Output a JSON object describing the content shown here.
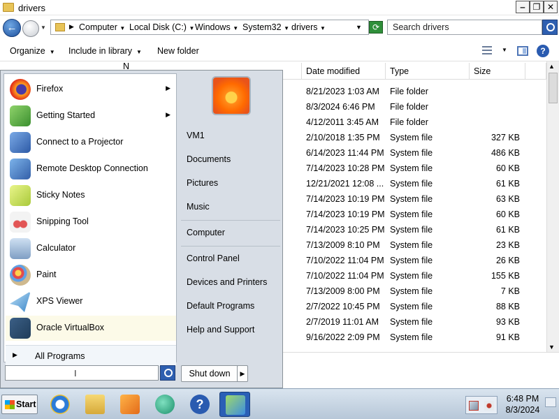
{
  "window": {
    "title": "drivers",
    "minimize_glyph": "‒",
    "maximize_glyph": "❐",
    "close_glyph": "✕"
  },
  "address": {
    "crumbs": [
      "Computer",
      "Local Disk (C:)",
      "Windows",
      "System32",
      "drivers"
    ],
    "search_placeholder": "Search drivers"
  },
  "toolbar": {
    "organize": "Organize",
    "include_in_library": "Include in library",
    "new_folder": "New folder"
  },
  "filelist": {
    "header_name_partial": "N",
    "headers": {
      "date": "Date modified",
      "type": "Type",
      "size": "Size"
    },
    "rows": [
      {
        "date": "8/21/2023 1:03 AM",
        "type": "File folder",
        "size": ""
      },
      {
        "date": "8/3/2024 6:46 PM",
        "type": "File folder",
        "size": ""
      },
      {
        "date": "4/12/2011 3:45 AM",
        "type": "File folder",
        "size": ""
      },
      {
        "date": "2/10/2018 1:35 PM",
        "type": "System file",
        "size": "327 KB"
      },
      {
        "date": "6/14/2023 11:44 PM",
        "type": "System file",
        "size": "486 KB"
      },
      {
        "date": "7/14/2023 10:28 PM",
        "type": "System file",
        "size": "60 KB"
      },
      {
        "date": "12/21/2021 12:08 ...",
        "type": "System file",
        "size": "61 KB"
      },
      {
        "date": "7/14/2023 10:19 PM",
        "type": "System file",
        "size": "63 KB"
      },
      {
        "date": "7/14/2023 10:19 PM",
        "type": "System file",
        "size": "60 KB"
      },
      {
        "date": "7/14/2023 10:25 PM",
        "type": "System file",
        "size": "61 KB"
      },
      {
        "date": "7/13/2009 8:10 PM",
        "type": "System file",
        "size": "23 KB"
      },
      {
        "date": "7/10/2022 11:04 PM",
        "type": "System file",
        "size": "26 KB"
      },
      {
        "date": "7/10/2022 11:04 PM",
        "type": "System file",
        "size": "155 KB"
      },
      {
        "date": "7/13/2009 8:00 PM",
        "type": "System file",
        "size": "7 KB"
      },
      {
        "date": "2/7/2022 10:45 PM",
        "type": "System file",
        "size": "88 KB"
      },
      {
        "date": "2/7/2019 11:01 AM",
        "type": "System file",
        "size": "93 KB"
      },
      {
        "date": "9/16/2022 2:09 PM",
        "type": "System file",
        "size": "91 KB"
      }
    ]
  },
  "start_menu": {
    "programs": [
      {
        "label": "Firefox",
        "icon": "firefox-icon",
        "submenu": true
      },
      {
        "label": "Getting Started",
        "icon": "getting-started-icon",
        "submenu": true
      },
      {
        "label": "Connect to a Projector",
        "icon": "projector-icon",
        "submenu": false
      },
      {
        "label": "Remote Desktop Connection",
        "icon": "remote-desktop-icon",
        "submenu": false
      },
      {
        "label": "Sticky Notes",
        "icon": "sticky-notes-icon",
        "submenu": false
      },
      {
        "label": "Snipping Tool",
        "icon": "snipping-tool-icon",
        "submenu": false
      },
      {
        "label": "Calculator",
        "icon": "calculator-icon",
        "submenu": false
      },
      {
        "label": "Paint",
        "icon": "paint-icon",
        "submenu": false
      },
      {
        "label": "XPS Viewer",
        "icon": "xps-viewer-icon",
        "submenu": false
      },
      {
        "label": "Oracle VirtualBox",
        "icon": "virtualbox-icon",
        "submenu": false
      }
    ],
    "all_programs": "All Programs",
    "right_links": {
      "user": "VM1",
      "documents": "Documents",
      "pictures": "Pictures",
      "music": "Music",
      "computer": "Computer",
      "control_panel": "Control Panel",
      "devices_printers": "Devices and Printers",
      "default_programs": "Default Programs",
      "help_support": "Help and Support"
    },
    "shutdown": "Shut down"
  },
  "taskbar": {
    "start_label": "Start",
    "apps": [
      "internet-explorer-icon",
      "file-explorer-icon",
      "media-player-icon",
      "app-globe-icon",
      "help-icon",
      "active-app-icon"
    ],
    "clock_time": "6:48 PM",
    "clock_date": "8/3/2024"
  },
  "colors": {
    "accent": "#2e5fb0",
    "start_menu_bg": "#d8dee6",
    "highlight_row": "#fcfae8"
  }
}
